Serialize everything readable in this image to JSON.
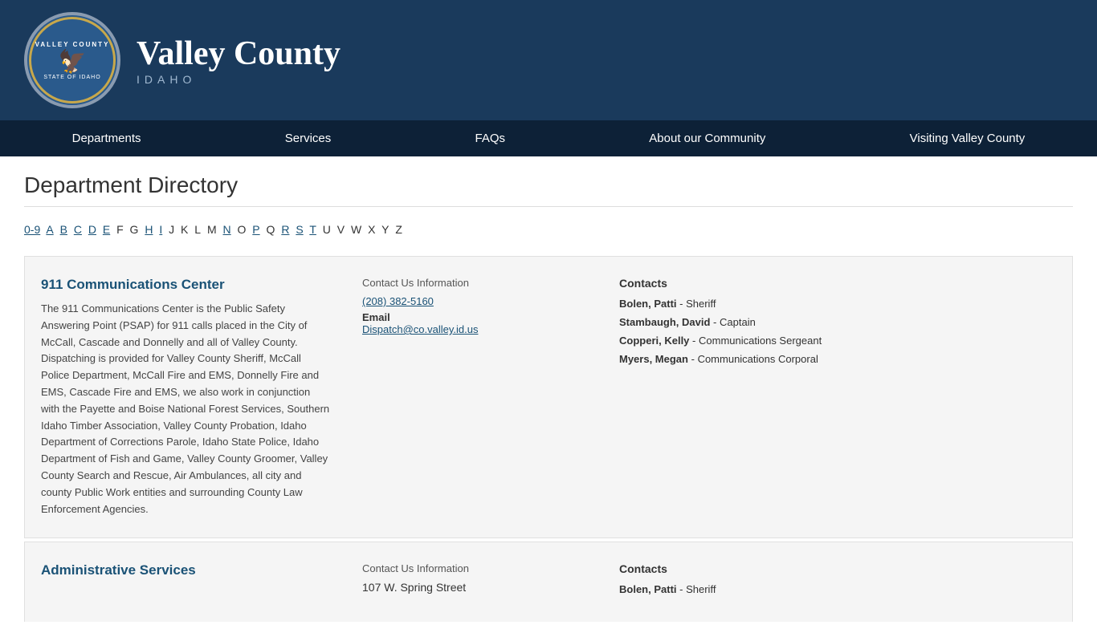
{
  "header": {
    "county_name": "Valley County",
    "state": "IDAHO",
    "logo_top": "VALLEY COUNTY",
    "logo_bottom": "STATE OF IDAHO",
    "logo_eagle": "🦅"
  },
  "nav": {
    "items": [
      {
        "label": "Departments",
        "href": "#"
      },
      {
        "label": "Services",
        "href": "#"
      },
      {
        "label": "FAQs",
        "href": "#"
      },
      {
        "label": "About our Community",
        "href": "#"
      },
      {
        "label": "Visiting Valley County",
        "href": "#"
      }
    ]
  },
  "page": {
    "title": "Department Directory"
  },
  "alpha_nav": {
    "links": [
      "0-9",
      "A",
      "B",
      "C",
      "D",
      "E",
      "H",
      "I",
      "N",
      "P",
      "R",
      "S",
      "T"
    ],
    "plain": [
      "F",
      "G",
      "J",
      "K",
      "L",
      "M",
      "O",
      "Q",
      "U",
      "V",
      "W",
      "X",
      "Y",
      "Z"
    ]
  },
  "departments": [
    {
      "name": "911 Communications Center",
      "description": "The 911 Communications Center is the Public Safety Answering Point (PSAP) for 911 calls placed in the City of McCall, Cascade and Donnelly and all of Valley County. Dispatching is provided for Valley County Sheriff, McCall Police Department, McCall Fire and EMS, Donnelly Fire and EMS, Cascade Fire and EMS, we also work in conjunction with the Payette and Boise National Forest Services, Southern Idaho Timber Association, Valley County Probation, Idaho Department of Corrections Parole, Idaho State Police, Idaho Department of Fish and Game, Valley County Groomer, Valley County Search and Rescue, Air Ambulances, all city and county Public Work entities and surrounding County Law Enforcement Agencies.",
      "contact_label": "Contact Us Information",
      "phone": "(208) 382-5160",
      "email_label": "Email",
      "email": "Dispatch@co.valley.id.us",
      "contacts_header": "Contacts",
      "contacts": [
        {
          "name": "Bolen, Patti",
          "role": "Sheriff"
        },
        {
          "name": "Stambaugh, David",
          "role": "Captain"
        },
        {
          "name": "Copperi, Kelly",
          "role": "Communications Sergeant"
        },
        {
          "name": "Myers, Megan",
          "role": "Communications Corporal"
        }
      ]
    },
    {
      "name": "Administrative Services",
      "description": "",
      "contact_label": "Contact Us Information",
      "phone": "",
      "address": "107 W. Spring Street",
      "email_label": "",
      "email": "",
      "contacts_header": "Contacts",
      "contacts": [
        {
          "name": "Bolen, Patti",
          "role": "Sheriff"
        }
      ]
    }
  ]
}
